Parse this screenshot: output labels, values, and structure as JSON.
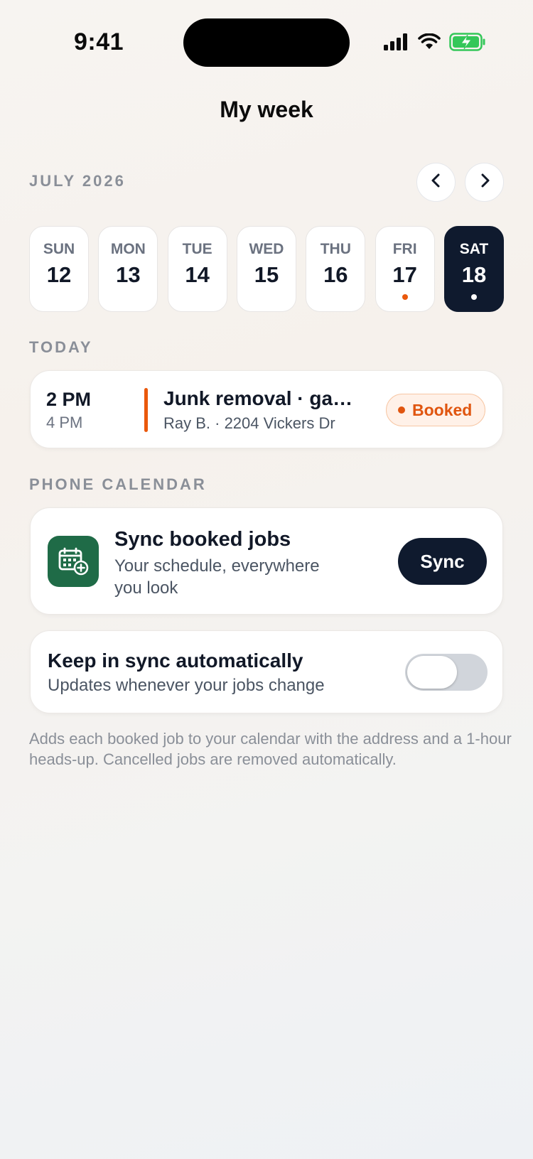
{
  "status_bar": {
    "time": "9:41",
    "icons": [
      "signal-icon",
      "wifi-icon",
      "battery-charging-icon"
    ],
    "battery_color": "#34c759"
  },
  "header": {
    "title": "My week"
  },
  "calendar": {
    "month_label": "JULY 2026",
    "prev_icon": "chevron-left-icon",
    "next_icon": "chevron-right-icon",
    "days": [
      {
        "dow": "SUN",
        "num": "12",
        "selected": false,
        "dot": null
      },
      {
        "dow": "MON",
        "num": "13",
        "selected": false,
        "dot": null
      },
      {
        "dow": "TUE",
        "num": "14",
        "selected": false,
        "dot": null
      },
      {
        "dow": "WED",
        "num": "15",
        "selected": false,
        "dot": null
      },
      {
        "dow": "THU",
        "num": "16",
        "selected": false,
        "dot": null
      },
      {
        "dow": "FRI",
        "num": "17",
        "selected": false,
        "dot": "#ea580c"
      },
      {
        "dow": "SAT",
        "num": "18",
        "selected": true,
        "dot": "#ffffff"
      }
    ]
  },
  "today": {
    "label": "TODAY",
    "job": {
      "start": "2 PM",
      "end": "4 PM",
      "title": "Junk removal · ga…",
      "subtitle": "Ray B. · 2204 Vickers Dr",
      "status": "Booked",
      "accent": "#ea580c"
    }
  },
  "phone_calendar": {
    "label": "PHONE CALENDAR",
    "sync": {
      "icon": "calendar-add-icon",
      "title": "Sync booked jobs",
      "subtitle": "Your schedule, everywhere you look",
      "button": "Sync"
    },
    "auto": {
      "title": "Keep in sync automatically",
      "subtitle": "Updates whenever your jobs change",
      "enabled": false
    },
    "footnote": "Adds each booked job to your calendar with the address and a 1-hour heads-up. Cancelled jobs are removed automatically."
  },
  "colors": {
    "navy": "#0f1a2e",
    "accent_orange": "#ea580c",
    "calendar_green": "#1f6b47"
  }
}
